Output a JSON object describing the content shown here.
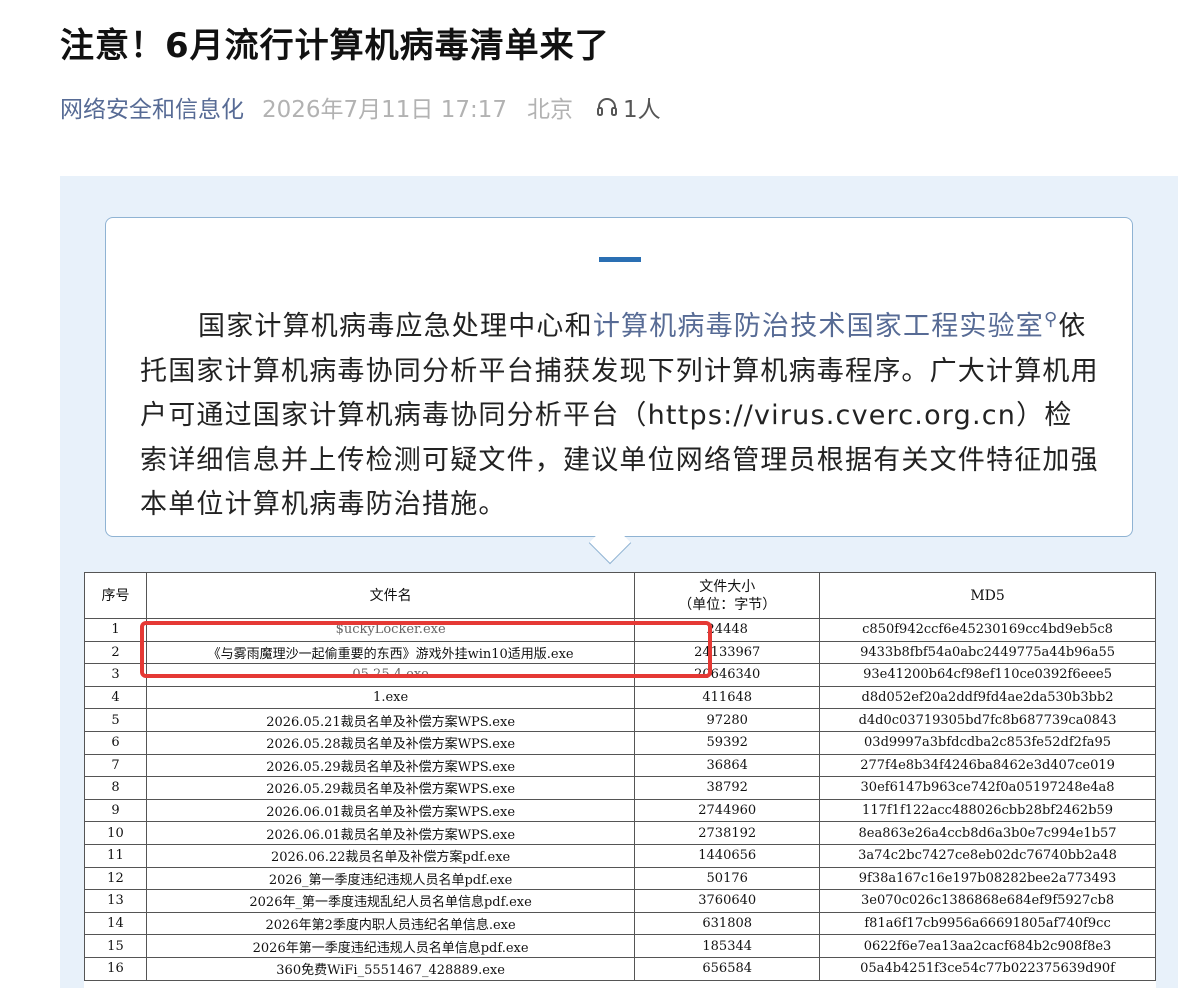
{
  "article": {
    "title": "注意！6月流行计算机病毒清单来了",
    "source": "网络安全和信息化",
    "date": "2026年7月11日 17:17",
    "location": "北京",
    "listeners": "1人"
  },
  "callout": {
    "text_before": "国家计算机病毒应急处理中心和",
    "link_text": "计算机病毒防治技术国家工程实验室",
    "text_after": "依托国家计算机病毒协同分析平台捕获发现下列计算机病毒程序。广大计算机用户可通过国家计算机病毒协同分析平台（https://virus.cverc.org.cn）检索详细信息并上传检测可疑文件，建议单位网络管理员根据有关文件特征加强本单位计算机病毒防治措施。"
  },
  "table": {
    "headers": {
      "index": "序号",
      "filename": "文件名",
      "size": "文件大小",
      "size_unit": "（单位：字节）",
      "md5": "MD5"
    },
    "rows": [
      {
        "index": "1",
        "filename": "$uckyLocker.exe",
        "size": "24448",
        "md5": "c850f942ccf6e45230169cc4bd9eb5c8"
      },
      {
        "index": "2",
        "filename": "《与雾雨魔理沙一起偷重要的东西》游戏外挂win10适用版.exe",
        "size": "24133967",
        "md5": "9433b8fbf54a0abc2449775a44b96a55"
      },
      {
        "index": "3",
        "filename": "05.25 4.exe",
        "size": "20646340",
        "md5": "93e41200b64cf98ef110ce0392f6eee5"
      },
      {
        "index": "4",
        "filename": "1.exe",
        "size": "411648",
        "md5": "d8d052ef20a2ddf9fd4ae2da530b3bb2"
      },
      {
        "index": "5",
        "filename": "2026.05.21裁员名单及补偿方案WPS.exe",
        "size": "97280",
        "md5": "d4d0c03719305bd7fc8b687739ca0843"
      },
      {
        "index": "6",
        "filename": "2026.05.28裁员名单及补偿方案WPS.exe",
        "size": "59392",
        "md5": "03d9997a3bfdcdba2c853fe52df2fa95"
      },
      {
        "index": "7",
        "filename": "2026.05.29裁员名单及补偿方案WPS.exe",
        "size": "36864",
        "md5": "277f4e8b34f4246ba8462e3d407ce019"
      },
      {
        "index": "8",
        "filename": "2026.05.29裁员名单及补偿方案WPS.exe",
        "size": "38792",
        "md5": "30ef6147b963ce742f0a05197248e4a8"
      },
      {
        "index": "9",
        "filename": "2026.06.01裁员名单及补偿方案WPS.exe",
        "size": "2744960",
        "md5": "117f1f122acc488026cbb28bf2462b59"
      },
      {
        "index": "10",
        "filename": "2026.06.01裁员名单及补偿方案WPS.exe",
        "size": "2738192",
        "md5": "8ea863e26a4ccb8d6a3b0e7c994e1b57"
      },
      {
        "index": "11",
        "filename": "2026.06.22裁员名单及补偿方案pdf.exe",
        "size": "1440656",
        "md5": "3a74c2bc7427ce8eb02dc76740bb2a48"
      },
      {
        "index": "12",
        "filename": "2026_第一季度违纪违规人员名单pdf.exe",
        "size": "50176",
        "md5": "9f38a167c16e197b08282bee2a773493"
      },
      {
        "index": "13",
        "filename": "2026年_第一季度违规乱纪人员名单信息pdf.exe",
        "size": "3760640",
        "md5": "3e070c026c1386868e684ef9f5927cb8"
      },
      {
        "index": "14",
        "filename": "2026年第2季度内职人员违纪名单信息.exe",
        "size": "631808",
        "md5": "f81a6f17cb9956a66691805af740f9cc"
      },
      {
        "index": "15",
        "filename": "2026年第一季度违纪违规人员名单信息pdf.exe",
        "size": "185344",
        "md5": "0622f6e7ea13aa2cacf684b2c908f8e3"
      },
      {
        "index": "16",
        "filename": "360免费WiFi_5551467_428889.exe",
        "size": "656584",
        "md5": "05a4b4251f3ce54c77b022375639d90f"
      }
    ]
  },
  "colors": {
    "link": "#576b95",
    "panel_bg": "#e8f1fa",
    "callout_border": "#8fb3d3",
    "highlight": "#e53935"
  },
  "icons": {
    "listen": "headphones-icon",
    "lens": "search-icon"
  }
}
